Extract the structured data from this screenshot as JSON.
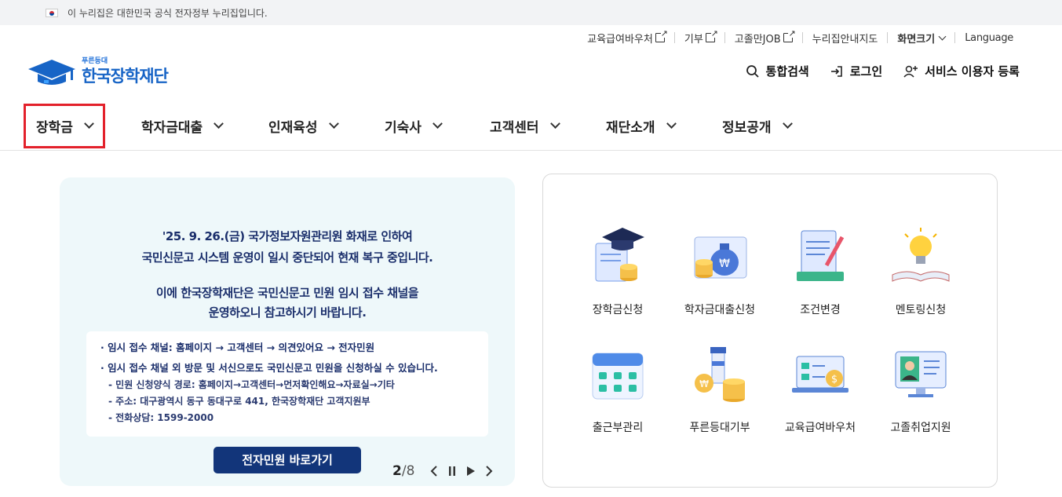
{
  "gov_banner": {
    "text": "이 누리집은 대한민국 공식 전자정부 누리집입니다."
  },
  "utility": {
    "links": [
      "교육급여바우처",
      "기부",
      "고졸만JOB",
      "누리집안내지도"
    ],
    "font_size_label": "화면크기",
    "language_label": "Language"
  },
  "logo": {
    "subtitle": "푸른등대",
    "title": "한국장학재단"
  },
  "actions": {
    "search": "통합검색",
    "login": "로그인",
    "register": "서비스 이용자 등록"
  },
  "nav": {
    "items": [
      "장학금",
      "학자금대출",
      "인재육성",
      "기숙사",
      "고객센터",
      "재단소개",
      "정보공개"
    ]
  },
  "banner": {
    "title_lines": [
      "'25. 9. 26.(금) 국가정보자원관리원 화재로 인하여",
      "국민신문고 시스템 운영이 일시 중단되어 현재 복구 중입니다.",
      "이에 한국장학재단은 국민신문고 민원 임시 접수 채널을",
      "운영하오니 참고하시기 바랍니다."
    ],
    "box_lines": [
      "· 임시 접수 채널: 홈페이지 → 고객센터 → 의견있어요 → 전자민원",
      "· 임시 접수 채널 외 방문 및 서신으로도 국민신문고 민원을 신청하실 수 있습니다.",
      "- 민원 신청양식 경로: 홈페이지→고객센터→먼저확인해요→자료실→기타",
      "- 주소: 대구광역시 동구 동대구로 441, 한국장학재단 고객지원부",
      "- 전화상담: 1599-2000"
    ],
    "button_label": "전자민원 바로가기",
    "page_current": "2",
    "page_total": "/8"
  },
  "quick_menu": {
    "items": [
      "장학금신청",
      "학자금대출신청",
      "조건변경",
      "멘토링신청",
      "출근부관리",
      "푸른등대기부",
      "교육급여바우처",
      "고졸취업지원"
    ],
    "icons": [
      "graduation-cap-icon",
      "money-bag-icon",
      "document-pencil-icon",
      "lightbulb-book-icon",
      "calendar-icon",
      "lighthouse-coins-icon",
      "voucher-laptop-icon",
      "job-profile-icon"
    ]
  },
  "colors": {
    "brand_blue": "#1764c6",
    "banner_text": "#1a2e6b",
    "button_navy": "#12357a",
    "highlight_red": "#e3212b"
  }
}
